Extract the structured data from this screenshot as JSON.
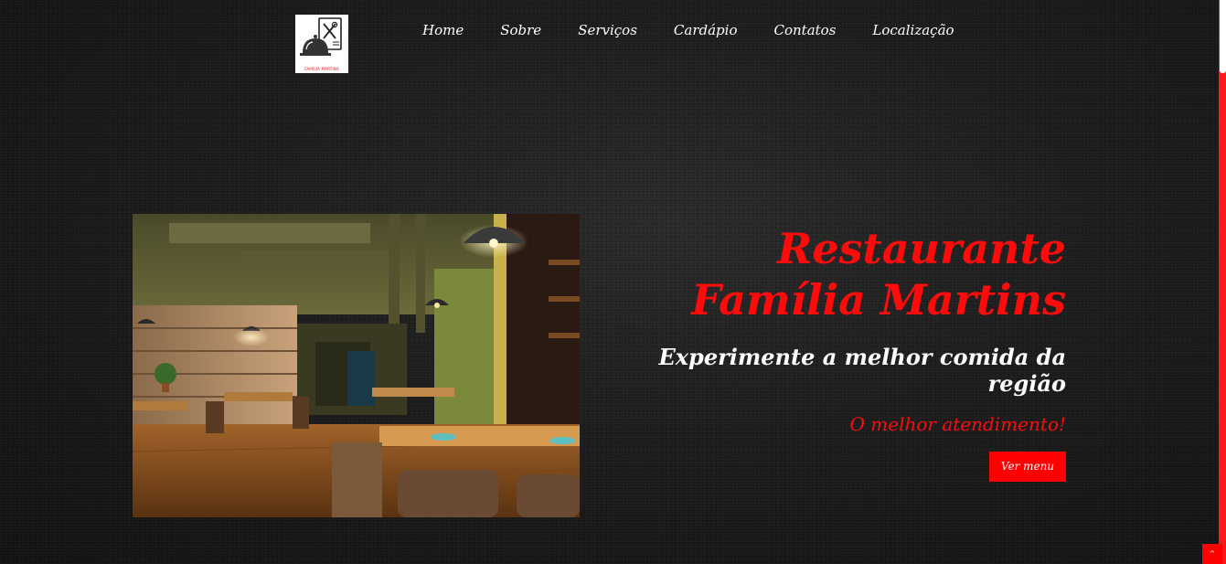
{
  "brand": {
    "logo_text": "FAMÍLIA MARTINS",
    "accent_color": "#ff0000"
  },
  "nav": {
    "items": [
      {
        "label": "Home"
      },
      {
        "label": "Sobre"
      },
      {
        "label": "Serviços"
      },
      {
        "label": "Cardápio"
      },
      {
        "label": "Contatos"
      },
      {
        "label": "Localização"
      }
    ]
  },
  "hero": {
    "title": "Restaurante Família Martins",
    "subtitle": "Experimente a melhor comida da região",
    "tagline": "O melhor atendimento!",
    "button_label": "Ver menu",
    "image_alt": "restaurant-interior-photo"
  },
  "back_to_top": {
    "icon": "chevron-up-icon",
    "glyph": "^"
  }
}
